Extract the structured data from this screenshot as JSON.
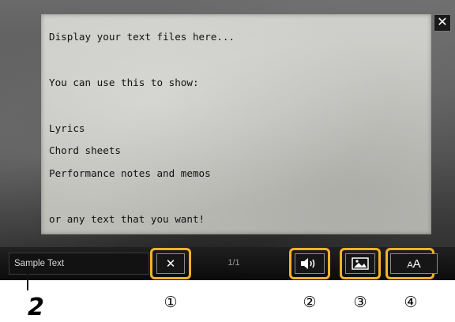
{
  "display_text": {
    "lines": [
      "Display your text files here...",
      "",
      "You can use this to show:",
      "",
      "Lyrics",
      "Chord sheets",
      "Performance notes and memos",
      "",
      "or any text that you want!"
    ]
  },
  "toolbar": {
    "file_name": "Sample Text",
    "page_indicator": "1/1",
    "close_glyph": "✕",
    "clear_glyph": "✕",
    "font_size_label": "AA"
  },
  "icons": {
    "close": "close-icon",
    "clear": "clear-icon",
    "speaker": "speaker-icon",
    "image": "image-icon",
    "font_size": "font-size-icon"
  },
  "callouts": {
    "c1": "①",
    "c2": "②",
    "c3": "③",
    "c4": "④",
    "step": "2"
  },
  "colors": {
    "highlight": "#f5b12a"
  }
}
